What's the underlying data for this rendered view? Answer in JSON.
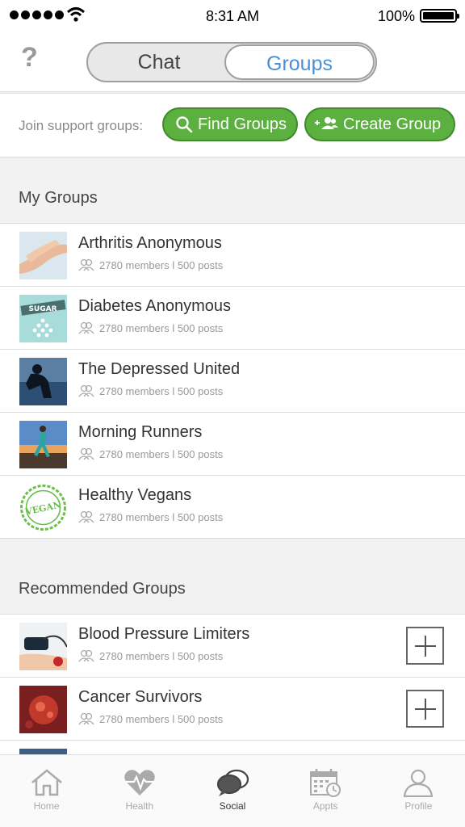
{
  "status_bar": {
    "time": "8:31 AM",
    "battery": "100%"
  },
  "header": {
    "help": "?",
    "segments": {
      "chat": "Chat",
      "groups": "Groups"
    }
  },
  "join": {
    "label": "Join support groups:",
    "find_button": "Find Groups",
    "create_button": "Create Group"
  },
  "my_groups": {
    "title": "My Groups",
    "items": [
      {
        "name": "Arthritis Anonymous",
        "meta": "2780 members l 500 posts"
      },
      {
        "name": "Diabetes Anonymous",
        "meta": "2780 members l 500 posts"
      },
      {
        "name": "The Depressed United",
        "meta": "2780 members l 500 posts"
      },
      {
        "name": "Morning Runners",
        "meta": "2780 members l 500 posts"
      },
      {
        "name": "Healthy Vegans",
        "meta": "2780 members l 500 posts"
      }
    ]
  },
  "recommended": {
    "title": "Recommended Groups",
    "items": [
      {
        "name": "Blood Pressure Limiters",
        "meta": "2780 members l 500 posts"
      },
      {
        "name": "Cancer Survivors",
        "meta": "2780 members l 500 posts"
      }
    ]
  },
  "tabs": [
    {
      "label": "Home",
      "icon": "home-icon"
    },
    {
      "label": "Health",
      "icon": "heart-pulse-icon"
    },
    {
      "label": "Social",
      "icon": "chat-bubbles-icon"
    },
    {
      "label": "Appts",
      "icon": "calendar-icon"
    },
    {
      "label": "Profile",
      "icon": "person-icon"
    }
  ],
  "thumb_text": {
    "sugar": "SUGAR",
    "vegan": "VEGAN"
  },
  "colors": {
    "accent_green": "#5cb040",
    "active_blue": "#4a90d9"
  }
}
